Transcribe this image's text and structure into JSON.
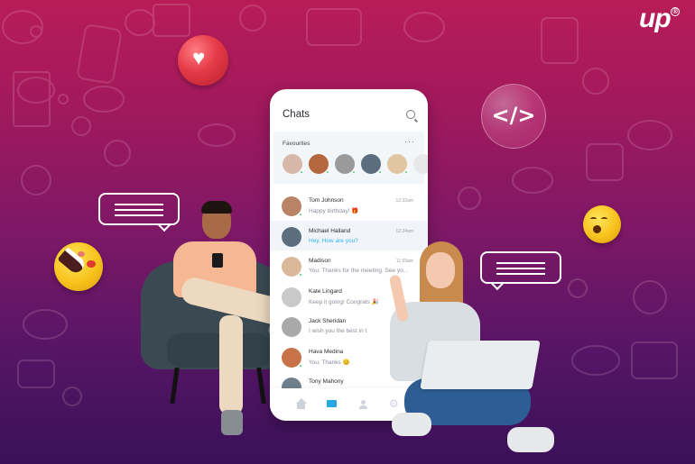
{
  "brand": {
    "logo_text": "up",
    "registered_mark": "®"
  },
  "decorations": {
    "heart_icon": "♥",
    "code_icon": "</>"
  },
  "phone": {
    "title": "Chats",
    "search_icon": "search-icon",
    "favourites": {
      "label": "Favourites",
      "more_icon": "···",
      "avatars": [
        {
          "color": "#d7b8a8",
          "online": true
        },
        {
          "color": "#b5673e",
          "online": true
        },
        {
          "color": "#9a9a9a",
          "online": true
        },
        {
          "color": "#5b6d7e",
          "online": true
        },
        {
          "color": "#e2c6a2",
          "online": true
        },
        {
          "color": "#e8e8e8",
          "online": false
        }
      ]
    },
    "chats": [
      {
        "name": "Tom Johnson",
        "message": "Happy birthday! 🎁",
        "time": "12:32am",
        "avatar_color": "#b98366",
        "online": true,
        "active": false
      },
      {
        "name": "Michael Halland",
        "message": "Hey, How are you?",
        "time": "12:24am",
        "avatar_color": "#5b6d7e",
        "online": false,
        "active": true
      },
      {
        "name": "Madison",
        "message": "You: Thanks for the meeting. See yo...",
        "time": "11:59am",
        "avatar_color": "#d9b99a",
        "online": true,
        "active": false
      },
      {
        "name": "Kate Lingard",
        "message": "Keep it going! Congrats 🎉",
        "time": "",
        "avatar_color": "#c9c9c9",
        "online": false,
        "active": false
      },
      {
        "name": "Jack Sheridan",
        "message": "I wish you the best in t",
        "time": "",
        "avatar_color": "#a9a9a9",
        "online": false,
        "active": false
      },
      {
        "name": "Hava Medina",
        "message": "You: Thanks 😊",
        "time": "",
        "avatar_color": "#c8724a",
        "online": true,
        "active": false
      },
      {
        "name": "Tony Mahony",
        "message": "",
        "time": "",
        "avatar_color": "#6f7f8c",
        "online": false,
        "active": false
      }
    ],
    "tabs": [
      {
        "name": "home",
        "active": false
      },
      {
        "name": "chats",
        "active": true
      },
      {
        "name": "contacts",
        "active": false
      },
      {
        "name": "settings",
        "active": false,
        "glyph": "⚙"
      }
    ]
  },
  "colors": {
    "bg_top": "#b81c58",
    "bg_bottom": "#3a1158",
    "accent_blue": "#25a9e8",
    "online_green": "#3fcf6d"
  }
}
